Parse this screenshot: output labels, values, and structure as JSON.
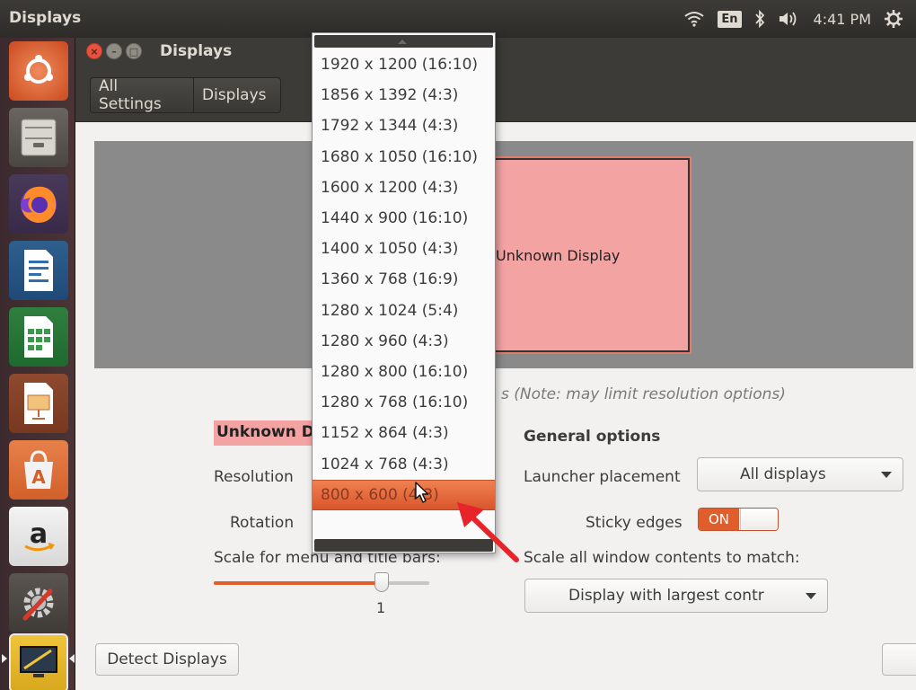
{
  "top_panel": {
    "app_title": "Displays",
    "keyboard_layout": "En",
    "clock": "4:41 PM",
    "icons": [
      "wifi-icon",
      "bluetooth-icon",
      "volume-icon",
      "power-gear-icon"
    ]
  },
  "launcher": {
    "items": [
      {
        "name": "ubuntu-dash-icon"
      },
      {
        "name": "files-icon"
      },
      {
        "name": "firefox-icon"
      },
      {
        "name": "writer-icon"
      },
      {
        "name": "calc-icon"
      },
      {
        "name": "impress-icon"
      },
      {
        "name": "software-center-icon"
      },
      {
        "name": "amazon-icon"
      },
      {
        "name": "system-settings-icon"
      },
      {
        "name": "displays-icon"
      }
    ]
  },
  "window": {
    "title": "Displays",
    "breadcrumb": {
      "all_settings": "All Settings",
      "displays": "Displays"
    }
  },
  "preview": {
    "monitor_label": "Unknown Display"
  },
  "mirror_note": "s (Note: may limit resolution options)",
  "display_section": {
    "name": "Unknown Di",
    "resolution_label": "Resolution",
    "rotation_label": "Rotation",
    "scale_label": "Scale for menu and title bars:",
    "scale_value": "1",
    "scale_fraction": 0.78
  },
  "general_options": {
    "heading": "General options",
    "launcher_placement_label": "Launcher placement",
    "launcher_placement_value": "All displays",
    "sticky_edges_label": "Sticky edges",
    "sticky_edges_state": "ON",
    "scale_all_label": "Scale all window contents to match:",
    "scale_all_value": "Display with largest contr"
  },
  "buttons": {
    "detect_displays": "Detect Displays"
  },
  "resolution_dropdown": {
    "options": [
      "1920 x 1200 (16:10)",
      "1856 x 1392 (4:3)",
      "1792 x 1344 (4:3)",
      "1680 x 1050 (16:10)",
      "1600 x 1200 (4:3)",
      "1440 x 900 (16:10)",
      "1400 x 1050 (4:3)",
      "1360 x 768 (16:9)",
      "1280 x 1024 (5:4)",
      "1280 x 960 (4:3)",
      "1280 x 800 (16:10)",
      "1280 x 768 (16:10)",
      "1152 x 864 (4:3)",
      "1024 x 768 (4:3)",
      "800 x 600 (4:3)"
    ],
    "selected": "800 x 600 (4:3)"
  },
  "colors": {
    "accent": "#e05e2c",
    "monitor_fill": "#f4a3a3",
    "panel": "#3c3b37",
    "annotation_arrow": "#e8232a"
  }
}
